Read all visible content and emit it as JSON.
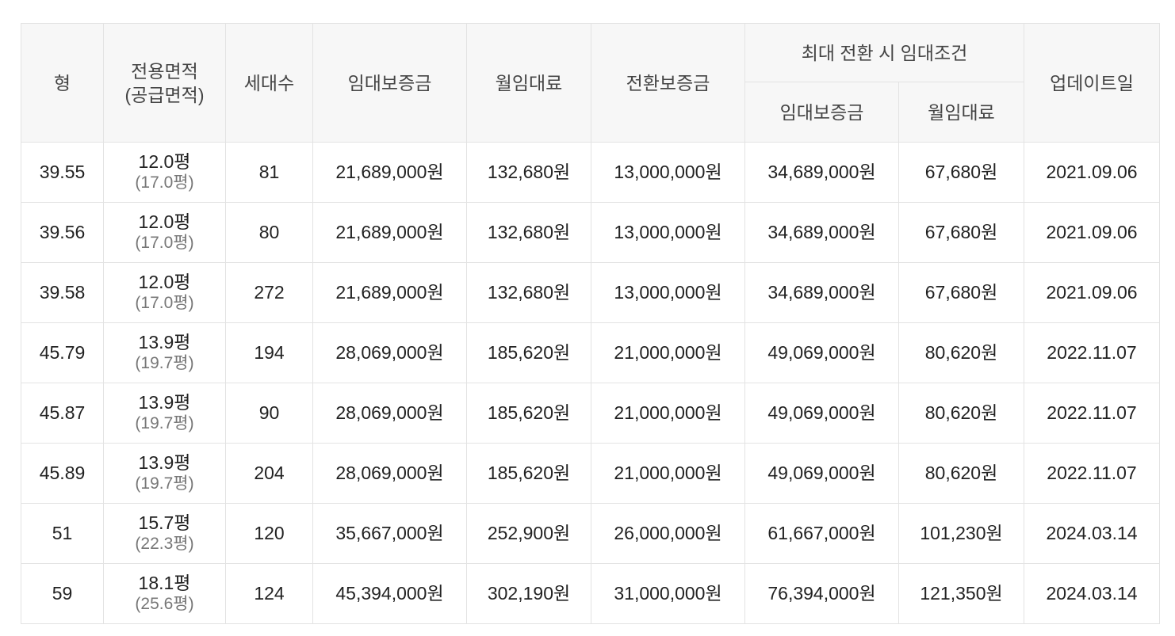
{
  "headers": {
    "type": "형",
    "area_line1": "전용면적",
    "area_line2": "(공급면적)",
    "households": "세대수",
    "deposit": "임대보증금",
    "monthly_rent": "월임대료",
    "conversion_deposit": "전환보증금",
    "max_conversion_group": "최대 전환 시 임대조건",
    "max_deposit": "임대보증금",
    "max_monthly_rent": "월임대료",
    "update_date": "업데이트일"
  },
  "rows": [
    {
      "type": "39.55",
      "area": "12.0평",
      "supply_area": "(17.0평)",
      "households": "81",
      "deposit": "21,689,000원",
      "monthly_rent": "132,680원",
      "conversion_deposit": "13,000,000원",
      "max_deposit": "34,689,000원",
      "max_monthly_rent": "67,680원",
      "update_date": "2021.09.06"
    },
    {
      "type": "39.56",
      "area": "12.0평",
      "supply_area": "(17.0평)",
      "households": "80",
      "deposit": "21,689,000원",
      "monthly_rent": "132,680원",
      "conversion_deposit": "13,000,000원",
      "max_deposit": "34,689,000원",
      "max_monthly_rent": "67,680원",
      "update_date": "2021.09.06"
    },
    {
      "type": "39.58",
      "area": "12.0평",
      "supply_area": "(17.0평)",
      "households": "272",
      "deposit": "21,689,000원",
      "monthly_rent": "132,680원",
      "conversion_deposit": "13,000,000원",
      "max_deposit": "34,689,000원",
      "max_monthly_rent": "67,680원",
      "update_date": "2021.09.06"
    },
    {
      "type": "45.79",
      "area": "13.9평",
      "supply_area": "(19.7평)",
      "households": "194",
      "deposit": "28,069,000원",
      "monthly_rent": "185,620원",
      "conversion_deposit": "21,000,000원",
      "max_deposit": "49,069,000원",
      "max_monthly_rent": "80,620원",
      "update_date": "2022.11.07"
    },
    {
      "type": "45.87",
      "area": "13.9평",
      "supply_area": "(19.7평)",
      "households": "90",
      "deposit": "28,069,000원",
      "monthly_rent": "185,620원",
      "conversion_deposit": "21,000,000원",
      "max_deposit": "49,069,000원",
      "max_monthly_rent": "80,620원",
      "update_date": "2022.11.07"
    },
    {
      "type": "45.89",
      "area": "13.9평",
      "supply_area": "(19.7평)",
      "households": "204",
      "deposit": "28,069,000원",
      "monthly_rent": "185,620원",
      "conversion_deposit": "21,000,000원",
      "max_deposit": "49,069,000원",
      "max_monthly_rent": "80,620원",
      "update_date": "2022.11.07"
    },
    {
      "type": "51",
      "area": "15.7평",
      "supply_area": "(22.3평)",
      "households": "120",
      "deposit": "35,667,000원",
      "monthly_rent": "252,900원",
      "conversion_deposit": "26,000,000원",
      "max_deposit": "61,667,000원",
      "max_monthly_rent": "101,230원",
      "update_date": "2024.03.14"
    },
    {
      "type": "59",
      "area": "18.1평",
      "supply_area": "(25.6평)",
      "households": "124",
      "deposit": "45,394,000원",
      "monthly_rent": "302,190원",
      "conversion_deposit": "31,000,000원",
      "max_deposit": "76,394,000원",
      "max_monthly_rent": "121,350원",
      "update_date": "2024.03.14"
    }
  ]
}
